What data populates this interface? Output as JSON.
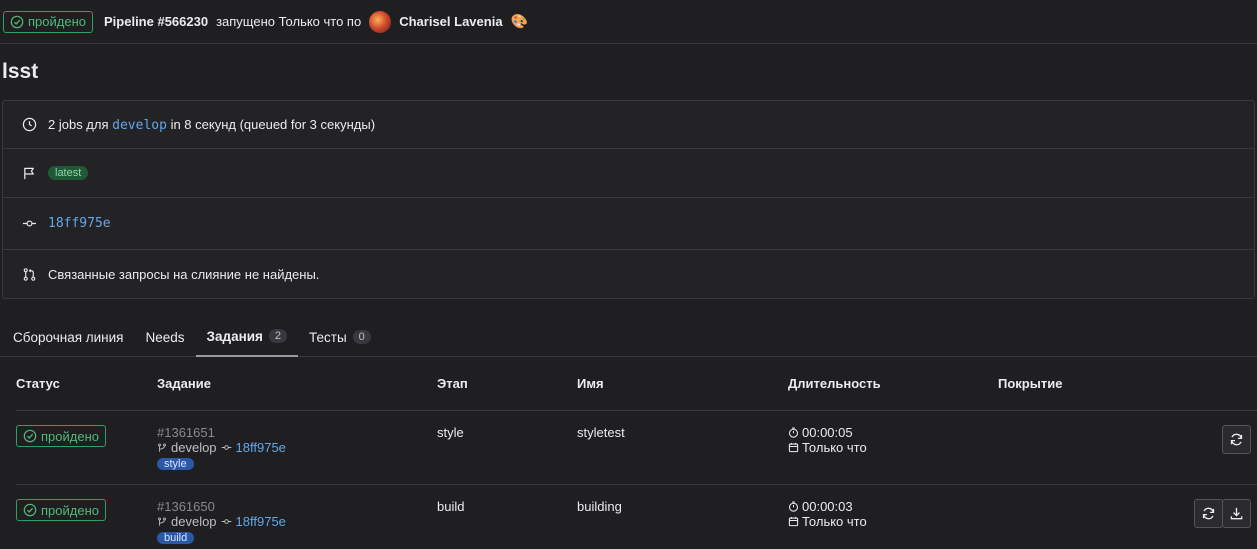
{
  "header": {
    "status": "пройдено",
    "pipeline": "Pipeline #566230",
    "text": "запущено Только что по",
    "author": "Charisel Lavenia",
    "author_emoji": "🎨"
  },
  "project_title": "lsst",
  "info": {
    "jobs_prefix": "2 jobs для",
    "branch": "develop",
    "jobs_suffix": "in 8 секунд (queued for 3 секунды)",
    "tag": "latest",
    "commit": "18ff975e",
    "mr_text": "Связанные запросы на слияние не найдены."
  },
  "tabs": [
    {
      "label": "Сборочная линия",
      "count": null
    },
    {
      "label": "Needs",
      "count": null
    },
    {
      "label": "Задания",
      "count": "2"
    },
    {
      "label": "Тесты",
      "count": "0"
    }
  ],
  "table": {
    "headers": [
      "Статус",
      "Задание",
      "Этап",
      "Имя",
      "Длительность",
      "Покрытие"
    ],
    "rows": [
      {
        "status": "пройдено",
        "job_id": "#1361651",
        "branch": "develop",
        "commit": "18ff975e",
        "stage_tag": "style",
        "stage": "style",
        "name": "styletest",
        "duration": "00:00:05",
        "finished": "Только что"
      },
      {
        "status": "пройдено",
        "job_id": "#1361650",
        "branch": "develop",
        "commit": "18ff975e",
        "stage_tag": "build",
        "stage": "build",
        "name": "building",
        "duration": "00:00:03",
        "finished": "Только что"
      }
    ]
  },
  "colors": {
    "background": "#1f1f21",
    "success": "#2da160",
    "link": "#63a6e9",
    "stage_tag": "#2b59a8"
  }
}
